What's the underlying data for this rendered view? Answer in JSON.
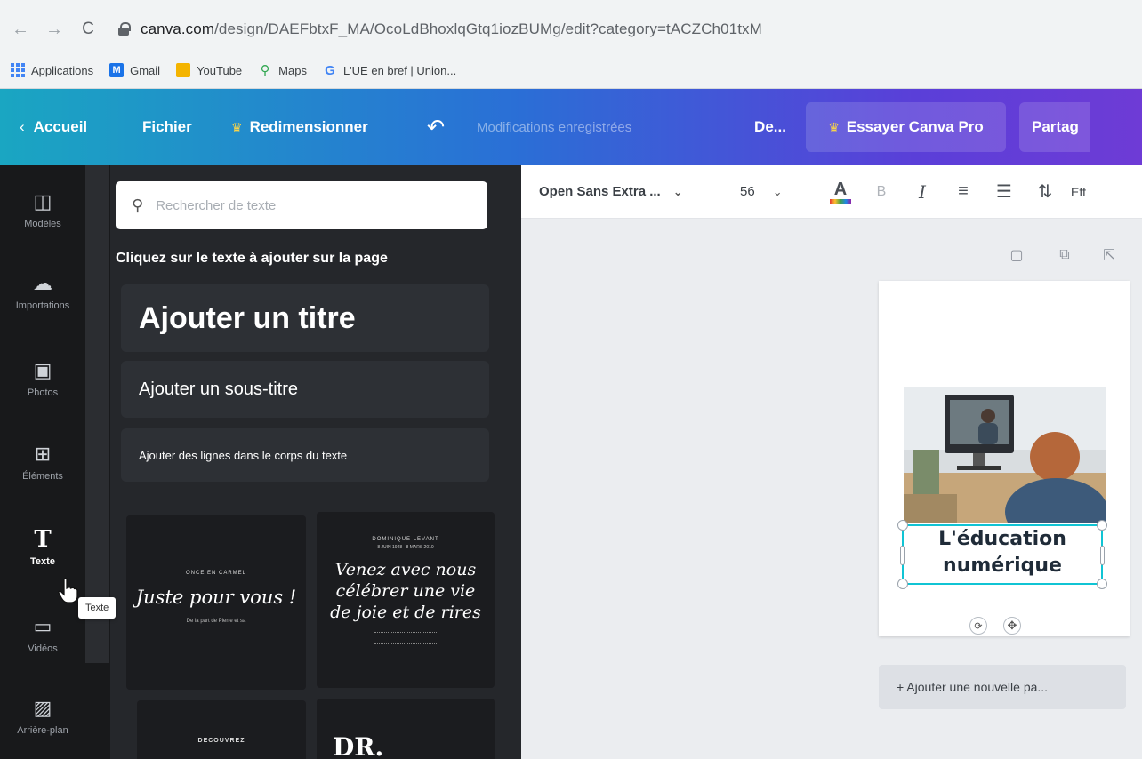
{
  "browser": {
    "url_host": "canva.com",
    "url_path": "/design/DAEFbtxF_MA/OcoLdBhoxlqGtq1iozBUMg/edit?category=tACZCh01txM",
    "bookmarks": [
      {
        "label": "Applications",
        "icon": "apps-grid-icon",
        "color": "#4285f4"
      },
      {
        "label": "Gmail",
        "icon": "gmail-icon",
        "color": "#1a73e8"
      },
      {
        "label": "YouTube",
        "icon": "folder-icon",
        "color": "#f4b400"
      },
      {
        "label": "Maps",
        "icon": "maps-pin-icon",
        "color": "#34a853"
      },
      {
        "label": "L'UE en bref | Union...",
        "icon": "google-icon",
        "color": "#4285f4"
      }
    ]
  },
  "topbar": {
    "home": "Accueil",
    "file": "Fichier",
    "resize": "Redimensionner",
    "saved_status": "Modifications enregistrées",
    "design": "De...",
    "try_pro": "Essayer Canva Pro",
    "share": "Partag"
  },
  "rail": {
    "items": [
      {
        "label": "Modèles",
        "icon": "templates-icon"
      },
      {
        "label": "Importations",
        "icon": "upload-cloud-icon"
      },
      {
        "label": "Photos",
        "icon": "photos-icon"
      },
      {
        "label": "Éléments",
        "icon": "elements-icon"
      },
      {
        "label": "Texte",
        "icon": "text-icon",
        "active": true
      },
      {
        "label": "Vidéos",
        "icon": "video-icon"
      },
      {
        "label": "Arrière-plan",
        "icon": "background-icon"
      }
    ],
    "tooltip": "Texte"
  },
  "panel": {
    "search_placeholder": "Rechercher de texte",
    "hint": "Cliquez sur le texte à ajouter sur la page",
    "add_title": "Ajouter un titre",
    "add_subtitle": "Ajouter un sous-titre",
    "add_body": "Ajouter des lignes dans le corps du texte",
    "templates": [
      {
        "small": "ONCE EN CARMEL",
        "script": "Juste pour vous !",
        "sub": "De la part de Pierre et sa"
      },
      {
        "top1": "DOMINIQUE LEVANT",
        "top2": "8 JUIN 1948 - 8 MARS 2010",
        "script1": "Venez avec nous",
        "script2": "célébrer une vie",
        "script3": "de joie et de rires"
      },
      {
        "small": "DECOUVREZ"
      },
      {
        "big": "DR."
      }
    ]
  },
  "toolbar": {
    "font": "Open Sans Extra ...",
    "size": "56",
    "bold": "B",
    "italic": "I",
    "effects": "Eff"
  },
  "design": {
    "text_line1": "L'éducation",
    "text_line2": "numérique",
    "add_page": "+ Ajouter une nouvelle pa..."
  },
  "colors": {
    "accent_cyan": "#10c4d4",
    "topbar_start": "#1aa6c2",
    "topbar_end": "#6e3bd6",
    "panel_bg": "#25272b",
    "rail_bg": "#18191b"
  }
}
